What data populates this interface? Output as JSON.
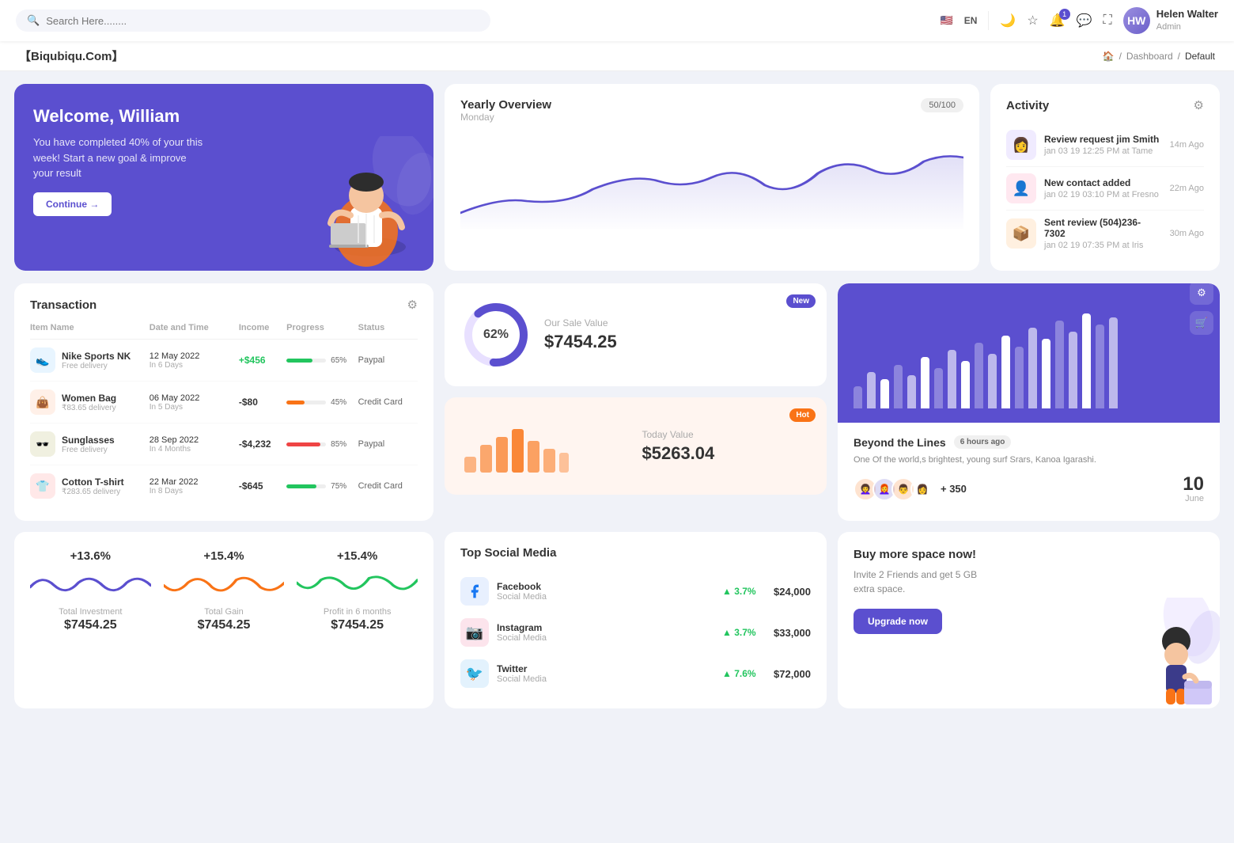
{
  "topnav": {
    "search_placeholder": "Search Here........",
    "lang": "EN",
    "notifications_count": "1",
    "user": {
      "name": "Helen Walter",
      "role": "Admin",
      "initials": "HW"
    }
  },
  "breadcrumb": {
    "brand": "【Biqubiqu.Com】",
    "items": [
      "Dashboard",
      "Default"
    ],
    "home_icon": "🏠"
  },
  "welcome": {
    "title": "Welcome, William",
    "subtitle": "You have completed 40% of your this week! Start a new goal & improve your result",
    "button": "Continue →"
  },
  "yearly_overview": {
    "title": "Yearly Overview",
    "day": "Monday",
    "badge": "50/100"
  },
  "activity": {
    "title": "Activity",
    "items": [
      {
        "title": "Review request jim Smith",
        "sub": "jan 03 19 12:25 PM at Tame",
        "time": "14m Ago",
        "emoji": "👩"
      },
      {
        "title": "New contact added",
        "sub": "jan 02 19 03:10 PM at Fresno",
        "time": "22m Ago",
        "emoji": "👤"
      },
      {
        "title": "Sent review (504)236-7302",
        "sub": "jan 02 19 07:35 PM at Iris",
        "time": "30m Ago",
        "emoji": "📦"
      }
    ]
  },
  "transaction": {
    "title": "Transaction",
    "columns": [
      "Item Name",
      "Date and Time",
      "Income",
      "Progress",
      "Status"
    ],
    "rows": [
      {
        "name": "Nike Sports NK",
        "sub": "Free delivery",
        "date": "12 May 2022",
        "days": "In 6 Days",
        "income": "+$456",
        "income_type": "pos",
        "progress": 65,
        "progress_color": "#22c55e",
        "status": "Paypal",
        "emoji": "👟",
        "icon_bg": "#e8f5ff"
      },
      {
        "name": "Women Bag",
        "sub": "₹83.65 delivery",
        "date": "06 May 2022",
        "days": "In 5 Days",
        "income": "-$80",
        "income_type": "neg",
        "progress": 45,
        "progress_color": "#f97316",
        "status": "Credit Card",
        "emoji": "👜",
        "icon_bg": "#fff0e8"
      },
      {
        "name": "Sunglasses",
        "sub": "Free delivery",
        "date": "28 Sep 2022",
        "days": "In 4 Months",
        "income": "-$4,232",
        "income_type": "neg",
        "progress": 85,
        "progress_color": "#ef4444",
        "status": "Paypal",
        "emoji": "🕶️",
        "icon_bg": "#f0f0e0"
      },
      {
        "name": "Cotton T-shirt",
        "sub": "₹283.65 delivery",
        "date": "22 Mar 2022",
        "days": "In 8 Days",
        "income": "-$645",
        "income_type": "neg",
        "progress": 75,
        "progress_color": "#22c55e",
        "status": "Credit Card",
        "emoji": "👕",
        "icon_bg": "#ffe8e8"
      }
    ]
  },
  "sale_value": {
    "title": "Our Sale Value",
    "amount": "$7454.25",
    "percent": "62%",
    "badge": "New"
  },
  "today_value": {
    "title": "Today Value",
    "amount": "$5263.04",
    "badge": "Hot"
  },
  "beyond": {
    "title": "Beyond the Lines",
    "time_ago": "6 hours ago",
    "desc": "One Of the world,s brightest, young surf Srars, Kanoa Igarashi.",
    "plus_count": "+ 350",
    "date_num": "10",
    "date_month": "June",
    "avatars": [
      "👩‍🦱",
      "👩‍🦰",
      "👨",
      "👩"
    ]
  },
  "metrics": {
    "items": [
      {
        "percent": "+13.6%",
        "label": "Total Investment",
        "value": "$7454.25",
        "wave_color": "#5b4fcf"
      },
      {
        "percent": "+15.4%",
        "label": "Total Gain",
        "value": "$7454.25",
        "wave_color": "#f97316"
      },
      {
        "percent": "+15.4%",
        "label": "Profit in 6 months",
        "value": "$7454.25",
        "wave_color": "#22c55e"
      }
    ]
  },
  "social_media": {
    "title": "Top Social Media",
    "items": [
      {
        "name": "Facebook",
        "type": "Social Media",
        "pct": "3.7%",
        "amount": "$24,000",
        "color": "#1877f2",
        "icon": "f"
      },
      {
        "name": "Instagram",
        "type": "Social Media",
        "pct": "3.7%",
        "amount": "$33,000",
        "color": "#e1306c",
        "icon": "📷"
      },
      {
        "name": "Twitter",
        "type": "Social Media",
        "pct": "7.6%",
        "amount": "$72,000",
        "color": "#1da1f2",
        "icon": "🐦"
      }
    ]
  },
  "buy_space": {
    "title": "Buy more space now!",
    "desc": "Invite 2 Friends and get 5 GB extra space.",
    "button": "Upgrade now"
  },
  "bar_chart": {
    "bars": [
      30,
      50,
      40,
      60,
      45,
      70,
      55,
      80,
      65,
      90,
      75,
      100,
      85,
      110,
      95,
      120,
      105,
      130,
      115,
      125
    ]
  }
}
